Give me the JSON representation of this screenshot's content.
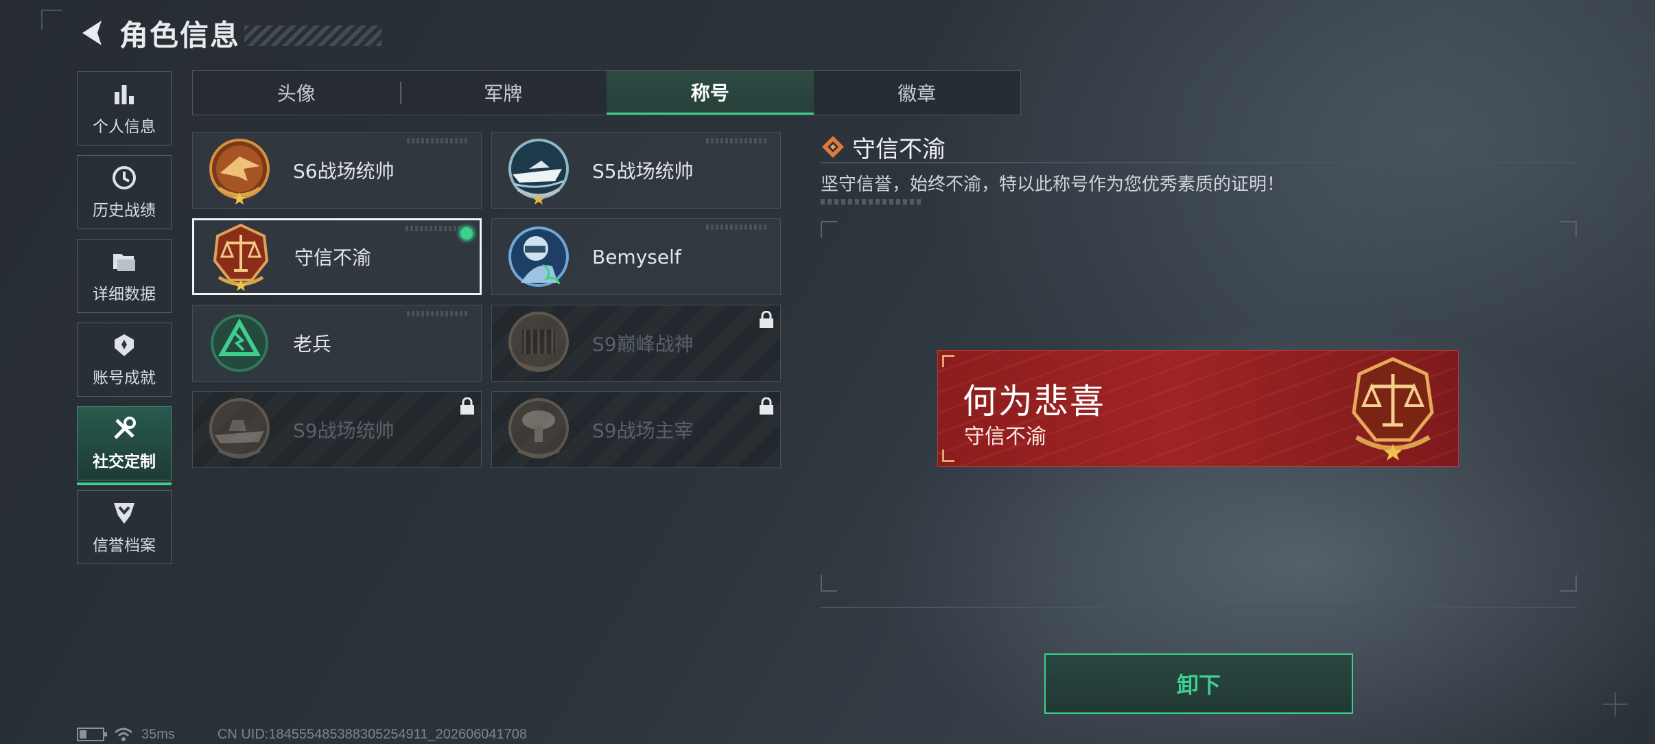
{
  "header": {
    "title": "角色信息"
  },
  "sidebar": {
    "items": [
      {
        "label": "个人信息",
        "icon": "bar-chart-icon"
      },
      {
        "label": "历史战绩",
        "icon": "history-clock-icon"
      },
      {
        "label": "详细数据",
        "icon": "folder-icon"
      },
      {
        "label": "账号成就",
        "icon": "achievement-icon"
      },
      {
        "label": "社交定制",
        "icon": "tools-icon",
        "active": true
      },
      {
        "label": "信誉档案",
        "icon": "shield-chevron-icon"
      }
    ]
  },
  "tabs": [
    {
      "label": "头像"
    },
    {
      "label": "军牌"
    },
    {
      "label": "称号",
      "active": true
    },
    {
      "label": "徽章"
    }
  ],
  "titles": [
    {
      "name": "S6战场统帅",
      "state": "unlocked"
    },
    {
      "name": "S5战场统帅",
      "state": "unlocked"
    },
    {
      "name": "守信不渝",
      "state": "equipped"
    },
    {
      "name": "Bemyself",
      "state": "unlocked"
    },
    {
      "name": "老兵",
      "state": "unlocked"
    },
    {
      "name": "S9巅峰战神",
      "state": "locked"
    },
    {
      "name": "S9战场统帅",
      "state": "locked"
    },
    {
      "name": "S9战场主宰",
      "state": "locked"
    }
  ],
  "detail": {
    "title": "守信不渝",
    "description": "坚守信誉，始终不渝，特以此称号作为您优秀素质的证明！"
  },
  "banner": {
    "title": "何为悲喜",
    "subtitle": "守信不渝"
  },
  "actions": {
    "unequip_label": "卸下"
  },
  "status": {
    "ping": "35ms",
    "uid": "CN UID:18455548538830525491​1_202606041708"
  },
  "colors": {
    "accent": "#3ecf8e",
    "banner": "#9e2424",
    "bronze": "#c77a3a"
  }
}
